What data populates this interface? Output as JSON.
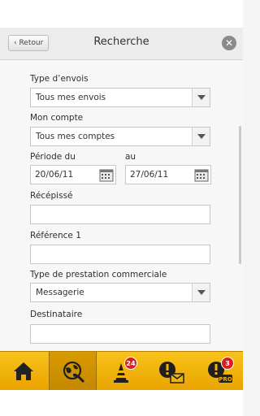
{
  "header": {
    "back_label": "‹ Retour",
    "title": "Recherche"
  },
  "form": {
    "type_envois_label": "Type d’envois",
    "type_envois_value": "Tous mes envois",
    "compte_label": "Mon compte",
    "compte_value": "Tous mes comptes",
    "periode_du_label": "Période du",
    "periode_au_label": "au",
    "date_from": "20/06/11",
    "date_to": "27/06/11",
    "recepisse_label": "Récépissé",
    "reference_label": "Référence 1",
    "prestation_label": "Type de prestation commerciale",
    "prestation_value": "Messagerie",
    "destinataire_label": "Destinataire"
  },
  "tabs": [
    {
      "icon": "home-icon"
    },
    {
      "icon": "globe-search-icon",
      "active": true
    },
    {
      "icon": "alert-cone-icon",
      "badge": "24"
    },
    {
      "icon": "alert-mail-icon"
    },
    {
      "icon": "alert-pro-icon",
      "badge": "3"
    }
  ],
  "colors": {
    "tabbar": "#f0b30a",
    "badge": "#d81f1f"
  }
}
